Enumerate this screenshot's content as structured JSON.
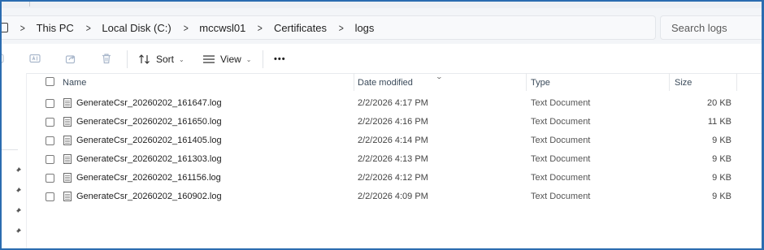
{
  "address_bar": {
    "breadcrumbs": [
      "This PC",
      "Local Disk (C:)",
      "mccwsl01",
      "Certificates",
      "logs"
    ]
  },
  "search": {
    "placeholder": "Search logs"
  },
  "toolbar": {
    "sort_label": "Sort",
    "view_label": "View",
    "more_label": "•••"
  },
  "file_list": {
    "columns": {
      "name": "Name",
      "date": "Date modified",
      "type": "Type",
      "size": "Size"
    },
    "rows": [
      {
        "name": "GenerateCsr_20260202_161647.log",
        "date": "2/2/2026 4:17 PM",
        "type": "Text Document",
        "size": "20 KB"
      },
      {
        "name": "GenerateCsr_20260202_161650.log",
        "date": "2/2/2026 4:16 PM",
        "type": "Text Document",
        "size": "11 KB"
      },
      {
        "name": "GenerateCsr_20260202_161405.log",
        "date": "2/2/2026 4:14 PM",
        "type": "Text Document",
        "size": "9 KB"
      },
      {
        "name": "GenerateCsr_20260202_161303.log",
        "date": "2/2/2026 4:13 PM",
        "type": "Text Document",
        "size": "9 KB"
      },
      {
        "name": "GenerateCsr_20260202_161156.log",
        "date": "2/2/2026 4:12 PM",
        "type": "Text Document",
        "size": "9 KB"
      },
      {
        "name": "GenerateCsr_20260202_160902.log",
        "date": "2/2/2026 4:09 PM",
        "type": "Text Document",
        "size": "9 KB"
      }
    ]
  },
  "colors": {
    "frame_border": "#2b6cb0",
    "toolbar_bg": "#f3f5f8"
  }
}
